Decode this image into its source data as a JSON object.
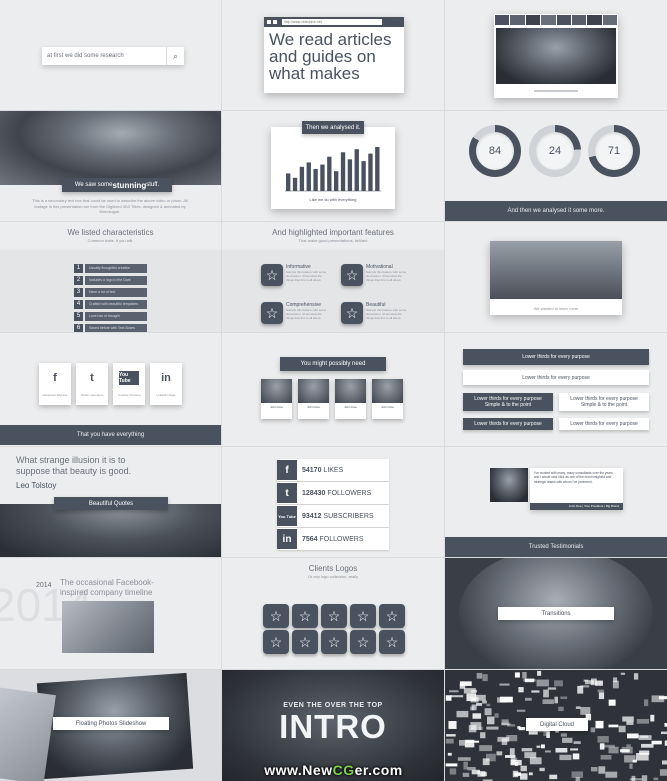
{
  "c1": {
    "search_placeholder": "at first we did some research"
  },
  "c2": {
    "url": "http://www.videohive.net",
    "headline": "We read articles and guides on what makes"
  },
  "c4": {
    "tag": "We saw some stunning stuff.",
    "tag_em": "stunning",
    "body": "This is a secondary text box that could be used to describe the above video or photo. All footage in this presentation are from the Digitized 3D3 Titles, designed & animated by Monologue."
  },
  "c5": {
    "tag": "Then we analysed it.",
    "caption": "Like we do with everything",
    "chart_data": {
      "type": "bar",
      "values": [
        40,
        30,
        55,
        65,
        50,
        60,
        78,
        45,
        88,
        72,
        95,
        68,
        85,
        100
      ]
    }
  },
  "c6": {
    "values": [
      "84",
      "24",
      "71"
    ],
    "fills": [
      84,
      24,
      71
    ],
    "bar": "And then we analysed it some more."
  },
  "c7": {
    "title": "We listed characteristics",
    "subtitle": "Common traits. If you will.",
    "items": [
      "Usually thoughtful creative",
      "Includes a logo to the Dark",
      "Have a lot of text",
      "Crafted with beautiful templates",
      "Love lots of thought",
      "Saved before with Text Boxes"
    ]
  },
  "c8": {
    "title": "And highlighted important features",
    "subtitle": "That make good presentations, brilliant",
    "features": [
      "Informative",
      "Motivational",
      "Comprehensive",
      "Beautiful"
    ],
    "feature_desc": "Sample this feature with some description. Show what the things that this is all about."
  },
  "c9": {
    "caption": "We wanted to learn more"
  },
  "c10": {
    "networks": [
      "f",
      "t",
      "You Tube",
      "in"
    ],
    "labels": [
      "Facebook Website",
      "Twitter username",
      "Youtube Channel",
      "LinkedIn Page"
    ],
    "bar": "That you have everything"
  },
  "c11": {
    "tag": "You might possibly need",
    "names": [
      "John Doe",
      "John Doe",
      "John Doe",
      "John Doe"
    ]
  },
  "c12": {
    "lower_thirds": [
      "Lower thirds for every purpose",
      "Lower thirds for every purpose",
      "Lower thirds for every purpose",
      "Lower thirds for every purpose",
      "Lower thirds for every purpose",
      "Lower thirds for every purpose"
    ],
    "simple": "Simple & to the point",
    "simple2": "Simple & to the point"
  },
  "c13": {
    "quote": "What strange illusion it is to suppose that beauty is good.",
    "author": "Leo Tolstoy",
    "tag": "Beautiful Quotes"
  },
  "c14": {
    "rows": [
      {
        "icon": "f",
        "num": "54170",
        "label": "LIKES"
      },
      {
        "icon": "t",
        "num": "128430",
        "label": "FOLLOWERS"
      },
      {
        "icon": "You Tube",
        "num": "93412",
        "label": "SUBSCRIBERS"
      },
      {
        "icon": "in",
        "num": "7564",
        "label": "FOLLOWERS"
      }
    ]
  },
  "c15": {
    "testimonial": "I've worked with many, many consultants over the years, and I would rank Nick as one of the most insightful and strategic teams with whom I've partnered.",
    "signature": "John Doe | Vice President | Big Brand",
    "bar": "Trusted Testimonials"
  },
  "c16": {
    "year": "2014",
    "big_year": "2014",
    "title": "The occasional Facebook-inspired company timeline"
  },
  "c17": {
    "title": "Clients Logos",
    "subtitle": "Or any logo collection, really"
  },
  "c18": {
    "tag": "Transitions"
  },
  "c19": {
    "tag": "Floating Photos Slideshow"
  },
  "c20": {
    "kicker": "EVEN THE OVER THE TOP",
    "title": "INTRO"
  },
  "c21": {
    "tag": "Digital Cloud"
  },
  "watermark": {
    "text": "www.NewCGer.com",
    "www": "www.",
    "brand1": "New",
    "brand2": "CG",
    "brand3": "er",
    "dotcom": ".com"
  }
}
